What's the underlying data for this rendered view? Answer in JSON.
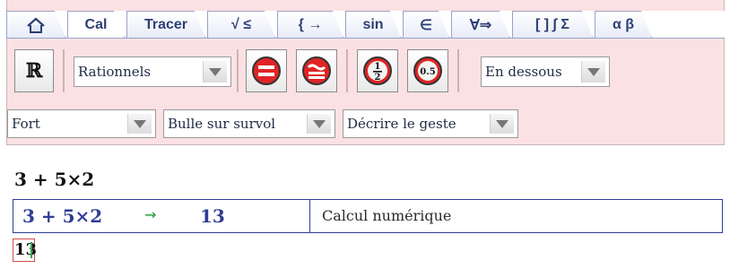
{
  "tabs": [
    {
      "label": "⌂",
      "icon": "home-icon",
      "active": false
    },
    {
      "label": "Cal",
      "active": true
    },
    {
      "label": "Tracer",
      "active": false
    },
    {
      "label": "√ ≤",
      "active": false
    },
    {
      "label": "{ →",
      "active": false
    },
    {
      "label": "sin",
      "active": false
    },
    {
      "label": "∈",
      "active": false
    },
    {
      "label": "∀⇒",
      "active": false
    },
    {
      "label": "[ ] ∫ Σ",
      "active": false
    },
    {
      "label": "α β",
      "active": false
    }
  ],
  "toolbar": {
    "set_button_label": "ℝ",
    "number_type_select": "Rationnels",
    "equals_button_label": "=",
    "approx_button_label": "≃",
    "fraction_button_label": "½",
    "decimal_button_label": "0.5",
    "position_select": "En dessous",
    "weight_select": "Fort",
    "tooltip_select": "Bulle sur survol",
    "gesture_select": "Décrire le geste"
  },
  "worksheet": {
    "expression": "3 + 5×2",
    "input_expression": "3 + 5×2",
    "arrow_symbol": "⇝",
    "input_result": "13",
    "description": "Calcul numérique",
    "result": "13"
  },
  "colors": {
    "toolbar_bg": "#fbe1e3",
    "tab_text": "#2d3f73",
    "button_red": "#d62020",
    "row_border": "#2f3d93"
  }
}
